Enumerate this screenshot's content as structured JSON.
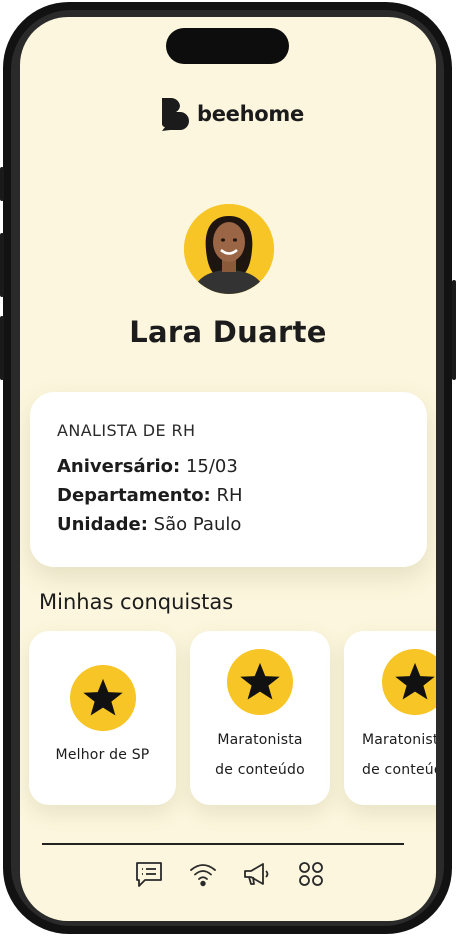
{
  "app": {
    "brand": "beehome"
  },
  "profile": {
    "name": "Lara Duarte",
    "role": "ANALISTA DE RH",
    "birthday_label": "Aniversário:",
    "birthday_value": "15/03",
    "department_label": "Departamento:",
    "department_value": "RH",
    "unit_label": "Unidade:",
    "unit_value": "São Paulo"
  },
  "achievements": {
    "title": "Minhas conquistas",
    "items": [
      {
        "line1": "Melhor de SP",
        "line2": "",
        "icon": "star-icon"
      },
      {
        "line1": "Maratonista",
        "line2": "de conteúdo",
        "icon": "star-icon"
      },
      {
        "line1": "Maratonista",
        "line2": "de conteúdo",
        "icon": "star-icon"
      }
    ]
  },
  "tabbar": {
    "items": [
      {
        "icon": "chat-icon"
      },
      {
        "icon": "wifi-icon"
      },
      {
        "icon": "megaphone-icon"
      },
      {
        "icon": "apps-grid-icon"
      }
    ]
  },
  "colors": {
    "background": "#fbf6dd",
    "accent": "#f7c525",
    "text": "#1c1c1c",
    "card": "#ffffff"
  }
}
